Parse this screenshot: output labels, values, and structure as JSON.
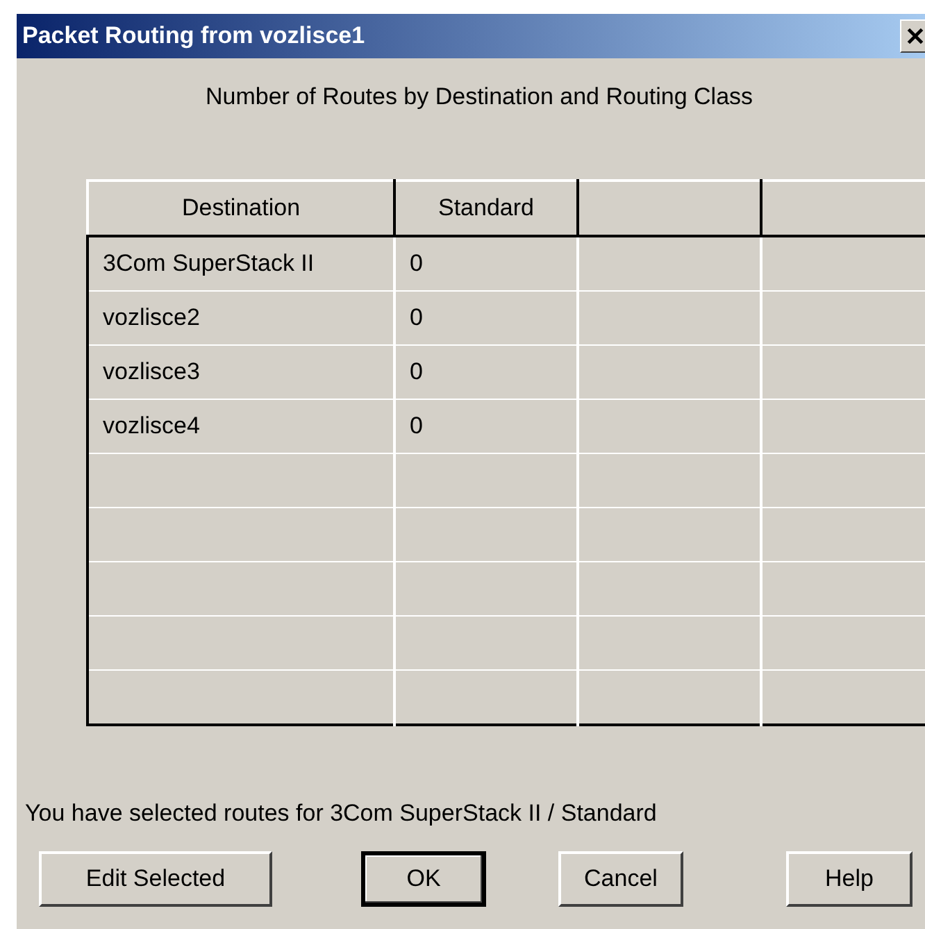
{
  "window": {
    "title": "Packet Routing from vozlisce1"
  },
  "heading": "Number of Routes by Destination and Routing Class",
  "table": {
    "columns": [
      "Destination",
      "Standard",
      "",
      ""
    ],
    "rows": [
      [
        "3Com SuperStack II",
        "0"
      ],
      [
        "vozlisce2",
        "0"
      ],
      [
        "vozlisce3",
        "0"
      ],
      [
        "vozlisce4",
        "0"
      ]
    ]
  },
  "status": "You have selected routes for 3Com SuperStack II / Standard",
  "buttons": [
    {
      "label": "Edit Selected",
      "default": false
    },
    {
      "label": "OK",
      "default": true
    },
    {
      "label": "Cancel",
      "default": false
    },
    {
      "label": "Help",
      "default": false
    }
  ]
}
